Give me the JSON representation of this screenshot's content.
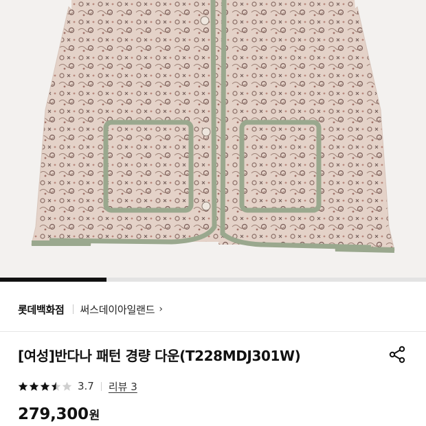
{
  "product_image": {
    "alt": "반다나 패턴 경량 다운 재킷",
    "icon": "quilted-jacket-image",
    "colors": {
      "fabric": "#e4d2c8",
      "pattern": "#8a6e66",
      "piping": "#9aa88e",
      "background": "#f3f1ef"
    }
  },
  "gallery": {
    "progress": 0.25
  },
  "brand": {
    "name": "롯데백화점",
    "shop": "써스데이아일랜드",
    "chevron": "›"
  },
  "product": {
    "title": "[여성]반다나 패턴 경량 다운(T228MDJ301W)"
  },
  "share": {
    "icon": "share-icon"
  },
  "rating": {
    "value": "3.7",
    "stars": 3.5,
    "max": 5,
    "review_label": "리뷰 3"
  },
  "price": {
    "value": "279,300",
    "unit": "원"
  }
}
